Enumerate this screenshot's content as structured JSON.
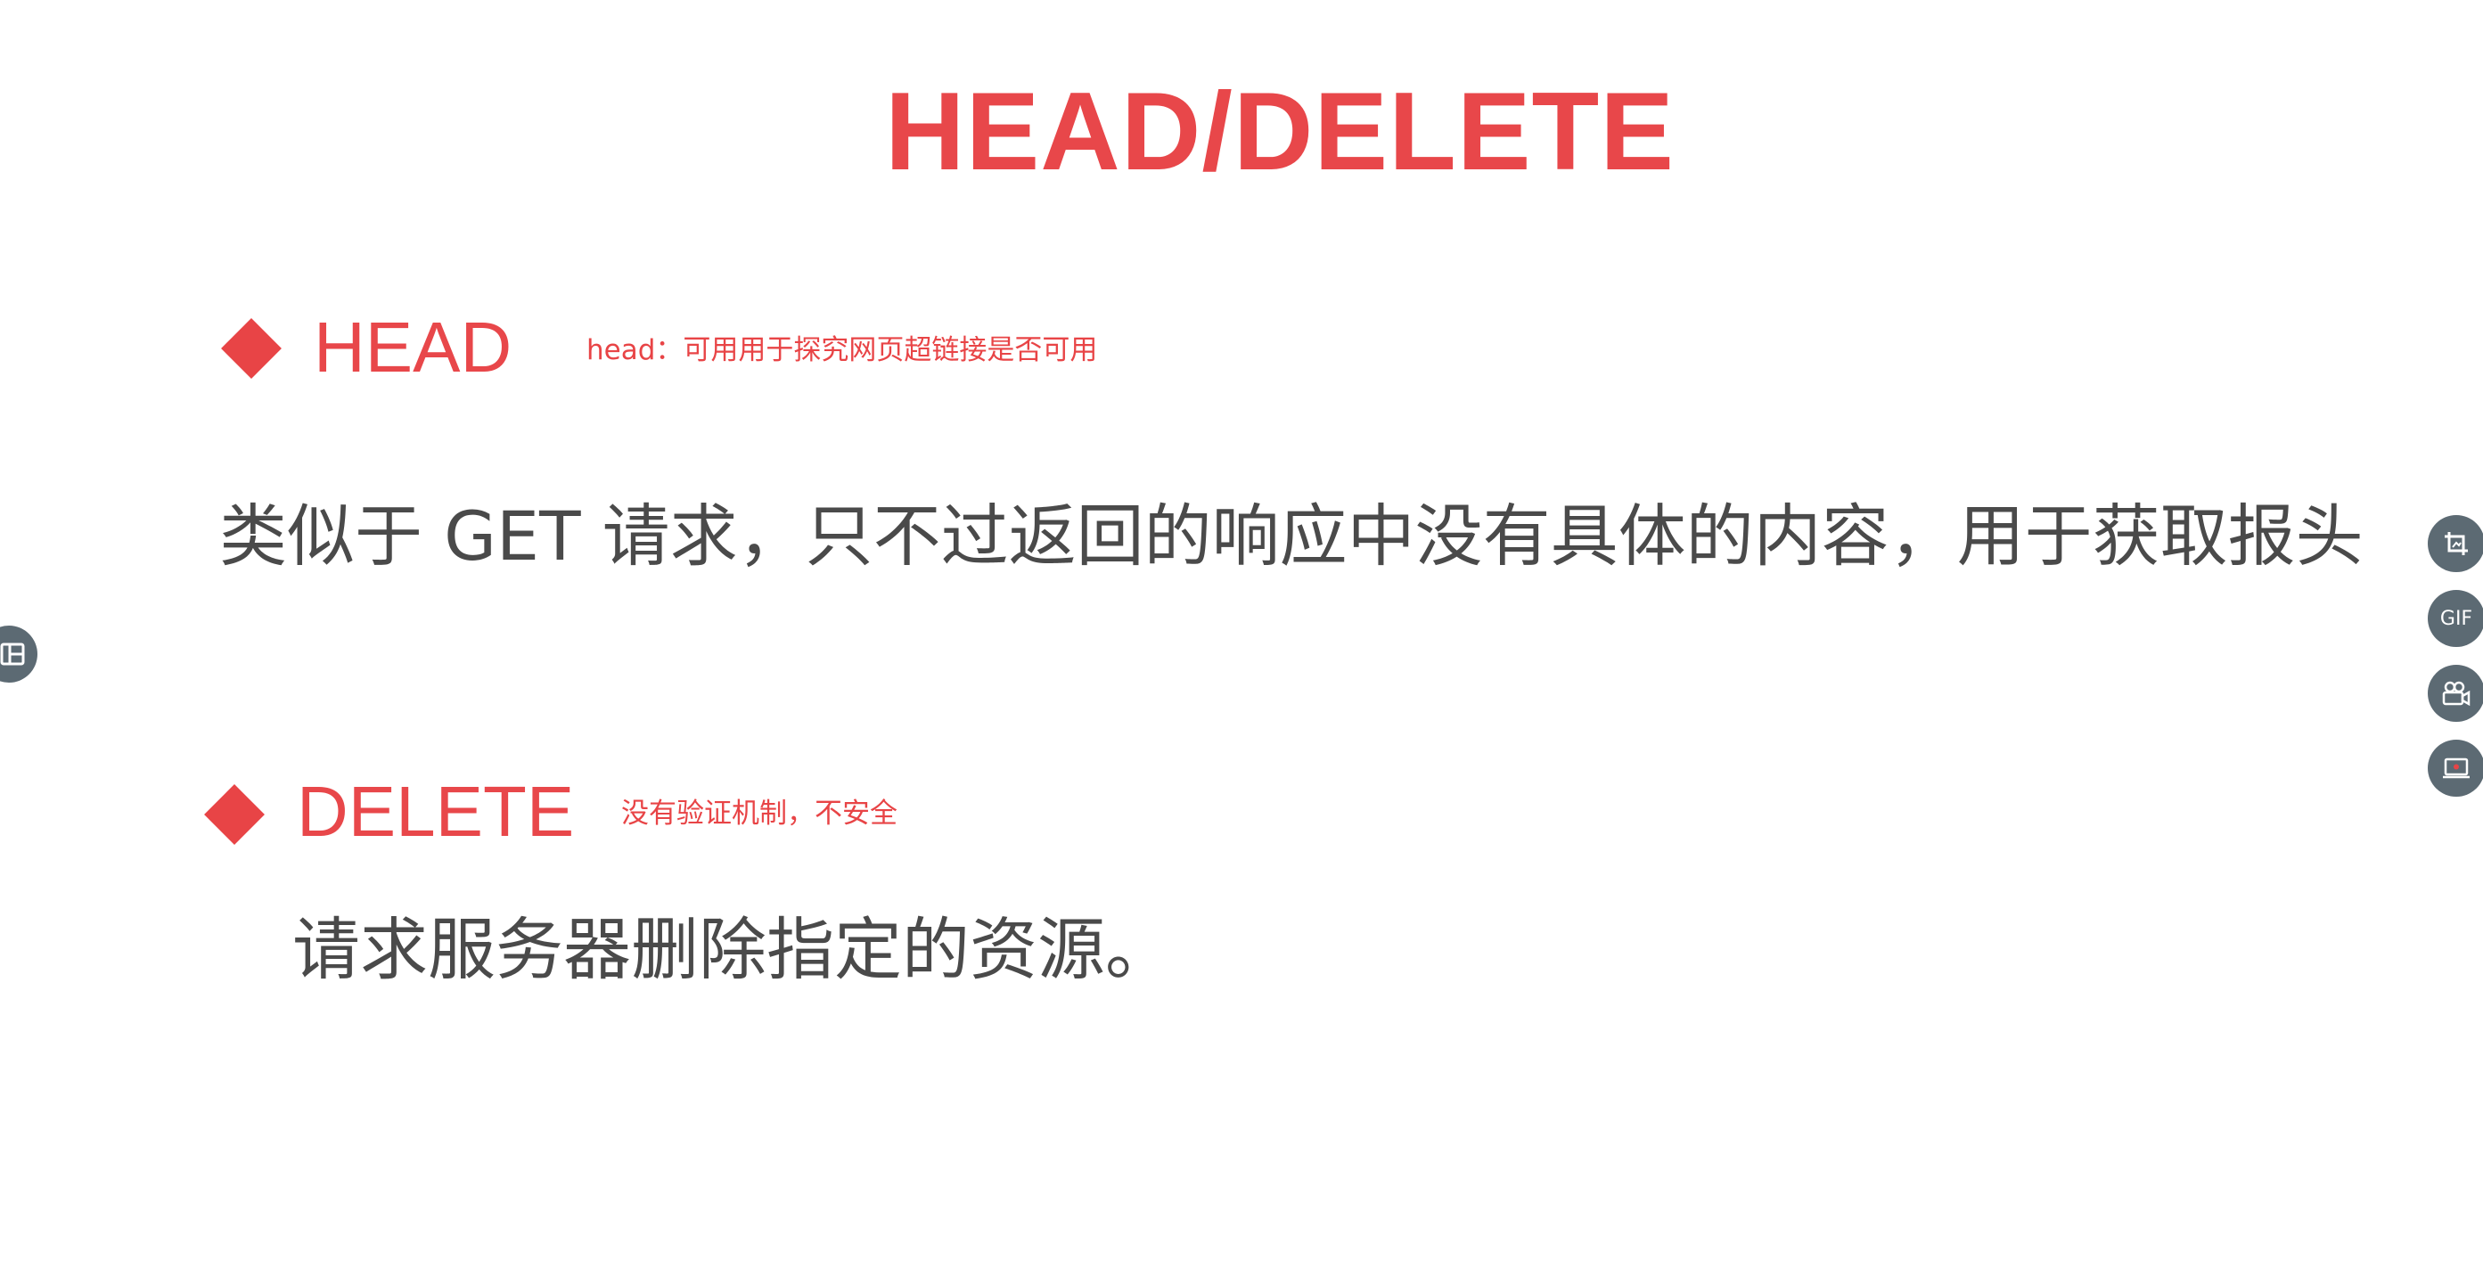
{
  "slide": {
    "title": "HEAD/DELETE",
    "sections": [
      {
        "heading": "HEAD",
        "annotation": "head：可用用于探究网页超链接是否可用",
        "body": "类似于 GET 请求，只不过返回的响应中没有具体的内容，用于获取报头"
      },
      {
        "heading": "DELETE",
        "annotation": "没有验证机制，不安全",
        "body": "请求服务器删除指定的资源。"
      }
    ]
  },
  "left_toolbar": {
    "icon": "layout-panel-icon"
  },
  "right_toolbar": {
    "items": [
      {
        "icon": "crop-screenshot-icon"
      },
      {
        "icon": "gif-icon",
        "label": "GIF"
      },
      {
        "icon": "video-camera-icon"
      },
      {
        "icon": "screen-record-icon"
      }
    ]
  },
  "colors": {
    "accent": "#e8474a",
    "body_text": "#4a4a4a",
    "toolbar_button": "#5c6a73",
    "background": "#ffffff"
  }
}
